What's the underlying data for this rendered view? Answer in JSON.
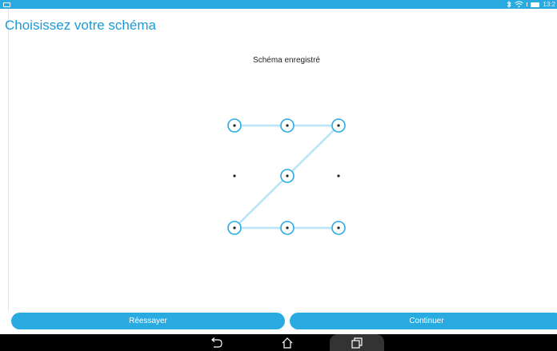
{
  "status_bar": {
    "time": "13:2",
    "colors": {
      "background": "#29abe2"
    },
    "icons": [
      "notification-icon",
      "bluetooth-icon",
      "wifi-icon",
      "battery-icon"
    ]
  },
  "header": {
    "title": "Choisissez votre schéma"
  },
  "pattern": {
    "subtitle": "Schéma enregistré",
    "grid": "3x3",
    "sequence": [
      1,
      2,
      3,
      5,
      7,
      8,
      9
    ],
    "colors": {
      "line": "#b8e4f7",
      "ring": "#29abe2",
      "dot": "#222222"
    }
  },
  "buttons": {
    "retry_label": "Réessayer",
    "continue_label": "Continuer"
  },
  "nav": {
    "icons": [
      "back-icon",
      "home-icon",
      "recent-apps-icon"
    ]
  }
}
